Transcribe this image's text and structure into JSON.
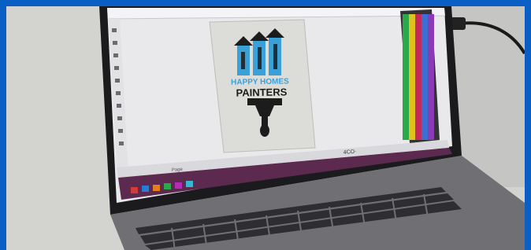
{
  "photo": {
    "frame_color": "#0a5fc4",
    "subject": "laptop-photo"
  },
  "logo": {
    "line1": "HAPPY HOMES",
    "line2": "PAINTERS",
    "accent_color": "#3aa0d8",
    "ink_color": "#1c1c1c"
  },
  "statusbar": {
    "zoom_text": "4CO·",
    "left_text": "Page"
  }
}
